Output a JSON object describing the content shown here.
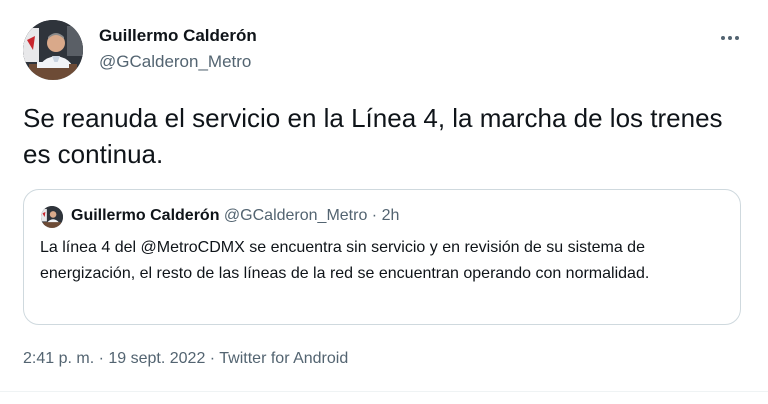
{
  "author": {
    "name": "Guillermo Calderón",
    "handle": "@GCalderon_Metro"
  },
  "tweet": {
    "text": "Se reanuda el servicio en la Línea 4, la marcha de los trenes es continua."
  },
  "quoted_tweet": {
    "name": "Guillermo Calderón",
    "handle": "@GCalderon_Metro",
    "separator": " · ",
    "time": "2h",
    "text": "La línea 4 del @MetroCDMX se encuentra sin servicio y en revisión de su sistema de energización, el resto de las líneas de la red se encuentran operando con normalidad."
  },
  "meta": {
    "time": "2:41 p. m.",
    "separator1": " · ",
    "date": "19 sept. 2022",
    "separator2": " · ",
    "source": "Twitter for Android"
  },
  "icons": {
    "more": "more-dots-icon",
    "avatar": "profile-photo"
  },
  "colors": {
    "text_primary": "#0f1419",
    "text_secondary": "#536471",
    "border": "#cfd9de"
  }
}
